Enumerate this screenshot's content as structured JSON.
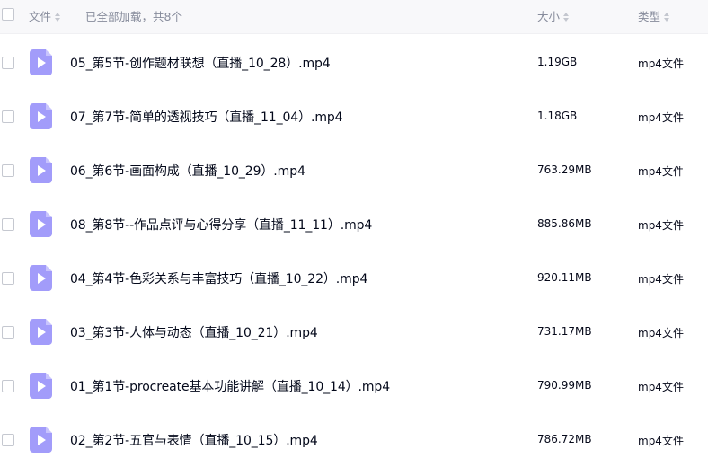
{
  "header": {
    "file_label": "文件",
    "count_text": "已全部加载，共8个",
    "size_label": "大小",
    "type_label": "类型"
  },
  "files": [
    {
      "name": "05_第5节-创作题材联想（直播_10_28）.mp4",
      "size": "1.19GB",
      "type": "mp4文件"
    },
    {
      "name": "07_第7节-简单的透视技巧（直播_11_04）.mp4",
      "size": "1.18GB",
      "type": "mp4文件"
    },
    {
      "name": "06_第6节-画面构成（直播_10_29）.mp4",
      "size": "763.29MB",
      "type": "mp4文件"
    },
    {
      "name": "08_第8节--作品点评与心得分享（直播_11_11）.mp4",
      "size": "885.86MB",
      "type": "mp4文件"
    },
    {
      "name": "04_第4节-色彩关系与丰富技巧（直播_10_22）.mp4",
      "size": "920.11MB",
      "type": "mp4文件"
    },
    {
      "name": "03_第3节-人体与动态（直播_10_21）.mp4",
      "size": "731.17MB",
      "type": "mp4文件"
    },
    {
      "name": "01_第1节-procreate基本功能讲解（直播_10_14）.mp4",
      "size": "790.99MB",
      "type": "mp4文件"
    },
    {
      "name": "02_第2节-五官与表情（直播_10_15）.mp4",
      "size": "786.72MB",
      "type": "mp4文件"
    }
  ],
  "icons": {
    "file_icon": "video-file-icon",
    "sort_icon": "sort-icon"
  },
  "colors": {
    "video_icon": "#a29cfa",
    "header_bg": "#f8f8fa",
    "header_text": "#878c9c"
  }
}
